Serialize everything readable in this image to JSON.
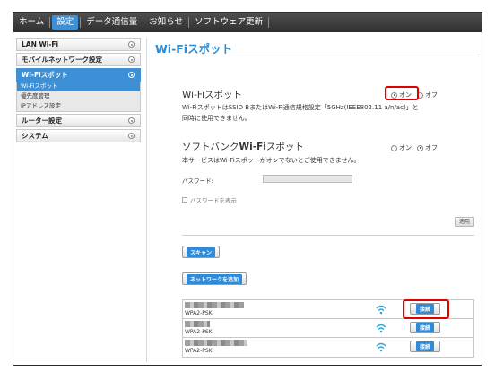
{
  "nav": {
    "items": [
      "ホーム",
      "設定",
      "データ通信量",
      "お知らせ",
      "ソフトウェア更新"
    ],
    "active_index": 1
  },
  "sidebar": {
    "items": [
      {
        "label": "LAN Wi-Fi"
      },
      {
        "label": "モバイルネットワーク設定"
      },
      {
        "label": "Wi-Fiスポット"
      },
      {
        "label": "ルーター設定"
      },
      {
        "label": "システム"
      }
    ],
    "sub_items": [
      {
        "label": "Wi-Fiスポット"
      },
      {
        "label": "優先度管理"
      },
      {
        "label": "IPアドレス設定"
      }
    ]
  },
  "page": {
    "title": "Wi-Fiスポット"
  },
  "wifi_spot": {
    "title": "Wi-Fiスポット",
    "on_label": "オン",
    "off_label": "オフ",
    "selected": "オン",
    "desc_line1": "Wi-FiスポットはSSID BまたはWi-Fi通信規格設定「5GHz(IEEE802.11 a/n/ac)」と",
    "desc_line2": "同時に使用できません。"
  },
  "softbank_spot": {
    "title_prefix": "ソフトバンク",
    "title_bold": "Wi-Fi",
    "title_suffix": "スポット",
    "on_label": "オン",
    "off_label": "オフ",
    "selected": "オフ",
    "desc": "本サービスはWi-Fiスポットがオンでないとご使用できません。",
    "password_label": "パスワード:",
    "password_value": "",
    "show_password_label": "パスワードを表示"
  },
  "buttons": {
    "apply": "適用",
    "scan": "スキャン",
    "add_network": "ネットワークを追加"
  },
  "networks": [
    {
      "security": "WPA2-PSK",
      "connect_label": "接続"
    },
    {
      "security": "WPA2-PSK",
      "connect_label": "接続"
    },
    {
      "security": "WPA2-PSK",
      "connect_label": "接続"
    }
  ],
  "colors": {
    "accent": "#2a8ad4",
    "active_bg": "#3d8fd6",
    "nav_bg": "#3a3a3a",
    "highlight": "#e00000",
    "wifi_icon": "#2fa8d8"
  },
  "icons": {
    "sidebar_indicator": "circle-dot-icon",
    "network_signal": "wifi-signal-icon"
  }
}
